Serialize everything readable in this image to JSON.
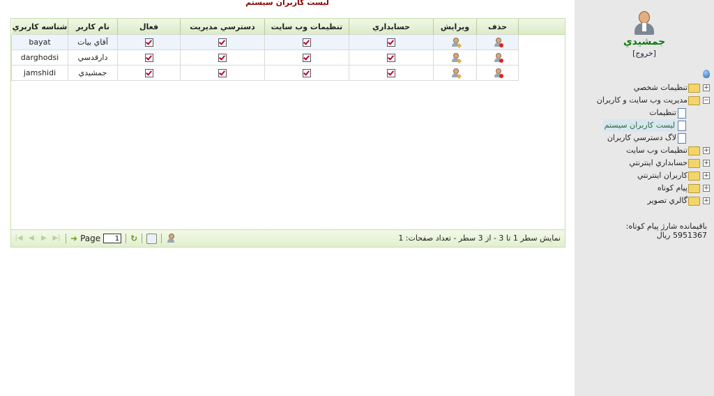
{
  "page_title": "لیست کاربران سیستم",
  "table": {
    "columns": [
      "حذف",
      "ویرایش",
      "حسابداري",
      "تنظيمات وب سايت",
      "دسترسي مديريت",
      "فعال",
      "نام کاربر",
      "شناسه کاربري"
    ],
    "rows": [
      {
        "name": "آقاي بيات",
        "id": "bayat"
      },
      {
        "name": "دارقدسي",
        "id": "darghodsi"
      },
      {
        "name": "جمشيدي",
        "id": "jamshidi"
      }
    ]
  },
  "pager": {
    "page_label": "Page",
    "page_value": "1",
    "info": "نمايش سطر 1 تا 3 - از 3 سطر - تعداد صفحات: 1"
  },
  "sidebar": {
    "username": "جمشيدي",
    "logout": "[خروج]",
    "tree": [
      {
        "label": "تنظيمات شخصي",
        "type": "folder",
        "expanded": false
      },
      {
        "label": "مديريت وب سايت و کاربران",
        "type": "folder",
        "expanded": true
      },
      {
        "label": "تنظيمات",
        "type": "doc",
        "selected": false
      },
      {
        "label": "ليست کاربران سيستم",
        "type": "doc",
        "selected": true
      },
      {
        "label": "لاگ دسترسي کاربران",
        "type": "doc",
        "selected": false
      },
      {
        "label": "تنظيمات وب سايت",
        "type": "folder",
        "expanded": false
      },
      {
        "label": "حسابداري اينترنتي",
        "type": "folder",
        "expanded": false
      },
      {
        "label": "کاربران اينترنتي",
        "type": "folder",
        "expanded": false
      },
      {
        "label": "پيام کوتاه",
        "type": "folder",
        "expanded": false
      },
      {
        "label": "گالري تصوير",
        "type": "folder",
        "expanded": false
      }
    ],
    "balance_label": "باقيمانده شارژ پيام کوتاه:",
    "balance_value": "5951367",
    "balance_unit": "ريال"
  },
  "colors": {
    "title": "#8b0000",
    "username": "#0b7a0b",
    "check": "#b0003a",
    "grid_border": "#c8dcae"
  }
}
